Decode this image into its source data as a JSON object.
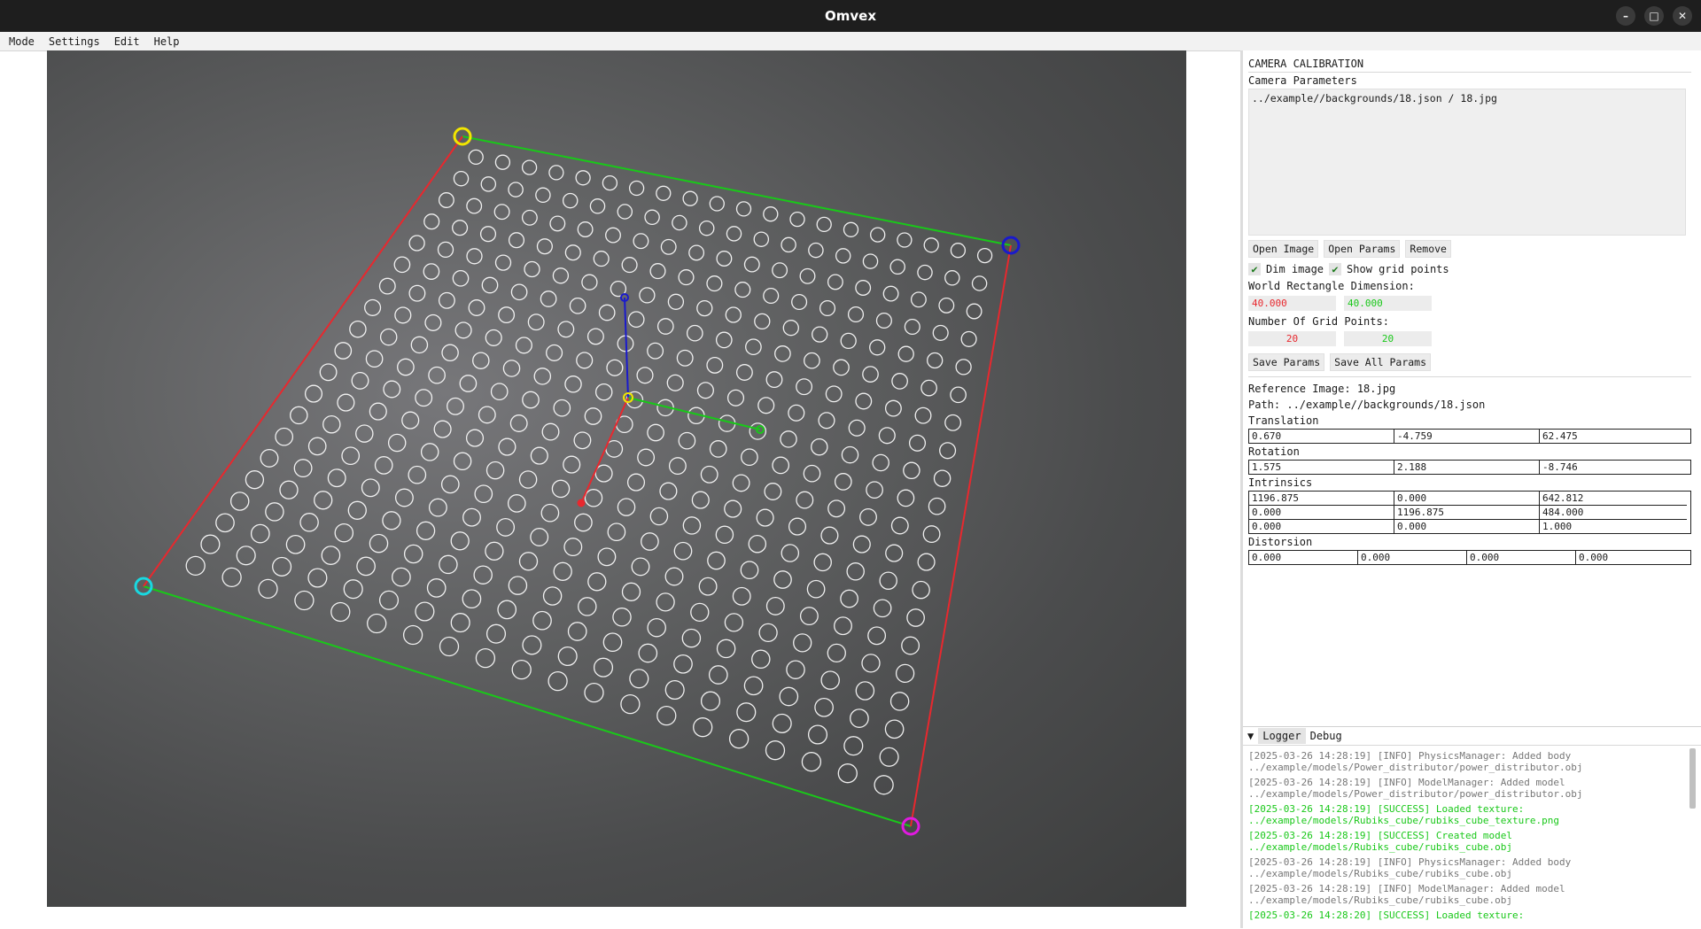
{
  "window": {
    "title": "Omvex"
  },
  "menu": [
    "Mode",
    "Settings",
    "Edit",
    "Help"
  ],
  "calibration": {
    "title": "CAMERA CALIBRATION",
    "params_label": "Camera Parameters",
    "params_entry": "../example//backgrounds/18.json / 18.jpg",
    "buttons": {
      "open_image": "Open Image",
      "open_params": "Open Params",
      "remove": "Remove"
    },
    "dim_image": "Dim image",
    "show_grid": "Show grid points",
    "world_rect_label": "World Rectangle Dimension:",
    "world_rect": [
      "40.000",
      "40.000"
    ],
    "grid_points_label": "Number Of Grid Points:",
    "grid_points": [
      "20",
      "20"
    ],
    "save_params": "Save Params",
    "save_all_params": "Save All Params",
    "reference_image": "Reference Image: 18.jpg",
    "path": "Path: ../example//backgrounds/18.json",
    "translation_label": "Translation",
    "translation": [
      "0.670",
      "-4.759",
      "62.475"
    ],
    "rotation_label": "Rotation",
    "rotation": [
      "1.575",
      "2.188",
      "-8.746"
    ],
    "intrinsics_label": "Intrinsics",
    "intrinsics": [
      "1196.875",
      "0.000",
      "642.812",
      "0.000",
      "1196.875",
      "484.000",
      "0.000",
      "0.000",
      "1.000"
    ],
    "distortion_label": "Distorsion",
    "distortion": [
      "0.000",
      "0.000",
      "0.000",
      "0.000"
    ]
  },
  "logger": {
    "tabs": [
      "Logger",
      "Debug"
    ],
    "lines": [
      {
        "text": "[2025-03-26 14:28:19] [INFO] PhysicsManager: Added body\n../example/models/Power_distributor/power_distributor.obj",
        "level": "info"
      },
      {
        "text": "[2025-03-26 14:28:19] [INFO] ModelManager: Added model\n../example/models/Power_distributor/power_distributor.obj",
        "level": "info"
      },
      {
        "text": "[2025-03-26 14:28:19] [SUCCESS] Loaded texture:\n../example/models/Rubiks_cube/rubiks_cube_texture.png",
        "level": "success"
      },
      {
        "text": "[2025-03-26 14:28:19] [SUCCESS] Created model\n../example/models/Rubiks_cube/rubiks_cube.obj",
        "level": "success"
      },
      {
        "text": "[2025-03-26 14:28:19] [INFO] PhysicsManager: Added body\n../example/models/Rubiks_cube/rubiks_cube.obj",
        "level": "info"
      },
      {
        "text": "[2025-03-26 14:28:19] [INFO] ModelManager: Added model\n../example/models/Rubiks_cube/rubiks_cube.obj",
        "level": "info"
      },
      {
        "text": "[2025-03-26 14:28:20] [SUCCESS] Loaded texture:",
        "level": "success"
      }
    ]
  },
  "colors": {
    "axis_x": "#e8282e",
    "axis_y": "#19c819",
    "axis_z": "#1a1acc",
    "success": "#19c819"
  }
}
